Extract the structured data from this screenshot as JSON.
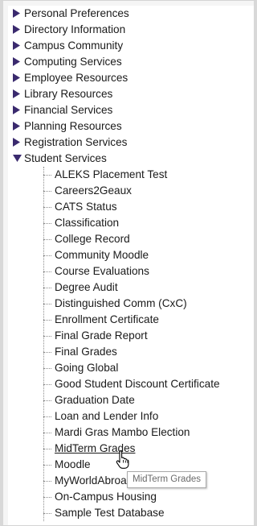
{
  "categories": [
    {
      "label": "Personal Preferences",
      "expanded": false
    },
    {
      "label": "Directory Information",
      "expanded": false
    },
    {
      "label": "Campus Community",
      "expanded": false
    },
    {
      "label": "Computing Services",
      "expanded": false
    },
    {
      "label": "Employee Resources",
      "expanded": false
    },
    {
      "label": "Library Resources",
      "expanded": false
    },
    {
      "label": "Financial Services",
      "expanded": false
    },
    {
      "label": "Planning Resources",
      "expanded": false
    },
    {
      "label": "Registration Services",
      "expanded": false
    },
    {
      "label": "Student Services",
      "expanded": true
    }
  ],
  "student_services": {
    "items": [
      {
        "label": "ALEKS Placement Test"
      },
      {
        "label": "Careers2Geaux"
      },
      {
        "label": "CATS Status"
      },
      {
        "label": "Classification"
      },
      {
        "label": "College Record"
      },
      {
        "label": "Community Moodle"
      },
      {
        "label": "Course Evaluations"
      },
      {
        "label": "Degree Audit"
      },
      {
        "label": "Distinguished Comm (CxC)"
      },
      {
        "label": "Enrollment Certificate"
      },
      {
        "label": "Final Grade Report"
      },
      {
        "label": "Final Grades"
      },
      {
        "label": "Going Global"
      },
      {
        "label": "Good Student Discount Certificate"
      },
      {
        "label": "Graduation Date"
      },
      {
        "label": "Loan and Lender Info"
      },
      {
        "label": "Mardi Gras Mambo Election"
      },
      {
        "label": "MidTerm Grades",
        "hovered": true
      },
      {
        "label": "Moodle"
      },
      {
        "label": "MyWorldAbroad"
      },
      {
        "label": "On-Campus Housing"
      },
      {
        "label": "Sample Test Database"
      }
    ]
  },
  "tooltip": {
    "text": "MidTerm Grades"
  },
  "icons": {
    "collapsed": "triangle-right-icon",
    "expanded": "triangle-down-icon",
    "cursor": "hand-pointer-icon"
  },
  "colors": {
    "arrow": "#3a2a6e",
    "text": "#1a1a1a",
    "tree_line": "#8c8c8c"
  }
}
